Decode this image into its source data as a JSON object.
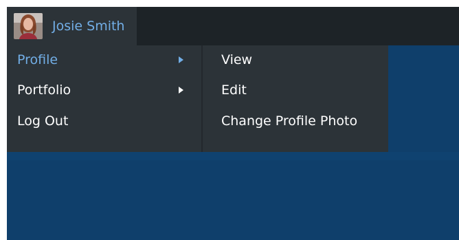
{
  "colors": {
    "toolbar_bg": "#1d2327",
    "menu_bg": "#2c3338",
    "accent_text": "#72aee6",
    "text": "#ffffff",
    "page_bg": "#0f3f6b"
  },
  "user": {
    "name": "Josie Smith",
    "avatar_icon": "user-avatar-photo"
  },
  "menu": {
    "items": [
      {
        "label": "Profile",
        "has_submenu": true,
        "active": true
      },
      {
        "label": "Portfolio",
        "has_submenu": true,
        "active": false
      },
      {
        "label": "Log Out",
        "has_submenu": false,
        "active": false
      }
    ]
  },
  "submenu": {
    "items": [
      {
        "label": "View"
      },
      {
        "label": "Edit"
      },
      {
        "label": "Change Profile Photo"
      }
    ]
  }
}
